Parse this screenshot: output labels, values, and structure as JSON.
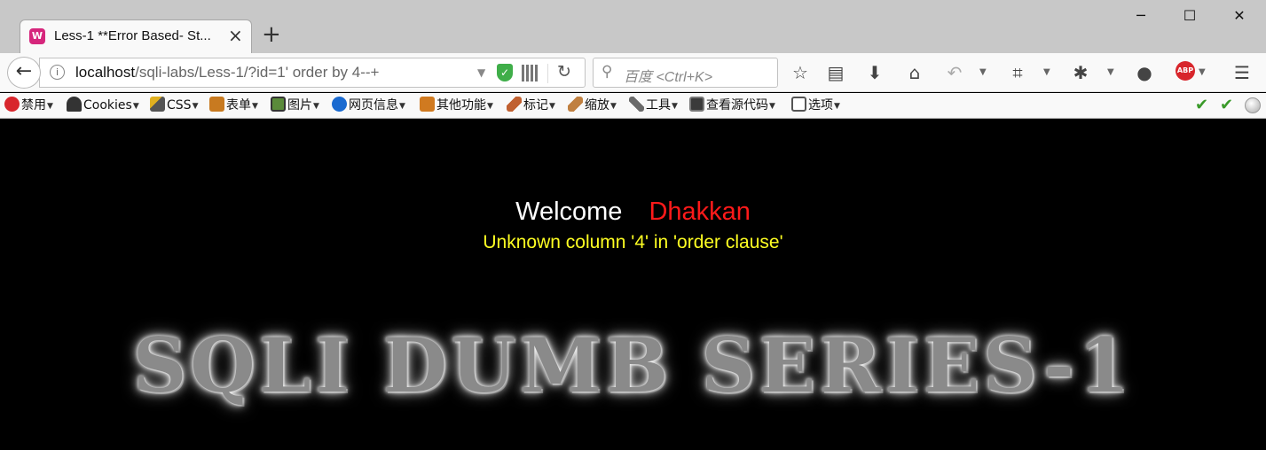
{
  "tab": {
    "title": "Less-1 **Error Based- St...",
    "favicon": "W"
  },
  "window": {
    "minimize": "─",
    "maximize": "☐",
    "close": "✕"
  },
  "address": {
    "host": "localhost",
    "path": "/sqli-labs/Less-1/?id=1' order by 4--+"
  },
  "search": {
    "placeholder": "百度 <Ctrl+K>"
  },
  "bookmarks": [
    {
      "label": "禁用",
      "color": "#d8262c"
    },
    {
      "label": "Cookies",
      "color": "#333333"
    },
    {
      "label": "CSS",
      "color": "#e0b020"
    },
    {
      "label": "表单",
      "color": "#c87a20"
    },
    {
      "label": "图片",
      "color": "#5a8a3a"
    },
    {
      "label": "网页信息",
      "color": "#1a6ad0"
    },
    {
      "label": "其他功能",
      "color": "#d07a20"
    },
    {
      "label": "标记",
      "color": "#c06030"
    },
    {
      "label": "缩放",
      "color": "#c08040"
    },
    {
      "label": "工具",
      "color": "#6a6a6a"
    },
    {
      "label": "查看源代码",
      "color": "#3a3a3a"
    },
    {
      "label": "选项",
      "color": "#555555"
    }
  ],
  "page": {
    "welcome": "Welcome",
    "name": "Dhakkan",
    "error": "Unknown column '4' in 'order clause'",
    "banner": "SQLI DUMB SERIES-1"
  },
  "colors": {
    "welcome": "#ffffff",
    "name": "#ff1a1a",
    "error": "#ffff22",
    "background": "#000000"
  }
}
